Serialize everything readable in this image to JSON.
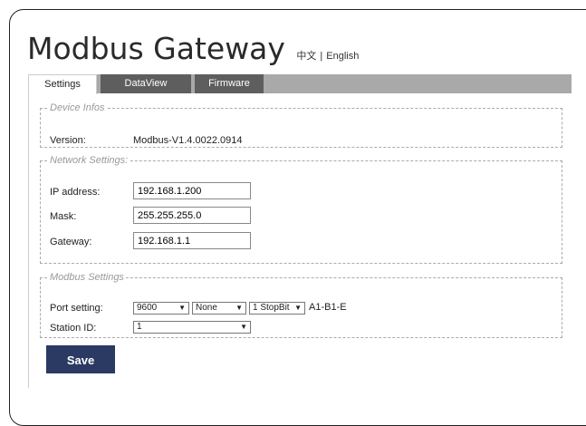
{
  "header": {
    "title": "Modbus Gateway",
    "lang_zh": "中文",
    "lang_sep": "|",
    "lang_en": "English"
  },
  "tabs": [
    {
      "label": "Settings",
      "active": true
    },
    {
      "label": "DataView",
      "active": false
    },
    {
      "label": "Firmware",
      "active": false
    }
  ],
  "device_infos": {
    "legend": "Device Infos",
    "version_label": "Version:",
    "version_value": "Modbus-V1.4.0022.0914"
  },
  "network": {
    "legend": "Network Settings:",
    "ip_label": "IP address:",
    "ip_value": "192.168.1.200",
    "mask_label": "Mask:",
    "mask_value": "255.255.255.0",
    "gateway_label": "Gateway:",
    "gateway_value": "192.168.1.1"
  },
  "modbus": {
    "legend": "Modbus Settings",
    "port_label": "Port setting:",
    "baud_value": "9600",
    "parity_value": "None",
    "stopbit_value": "1 StopBit",
    "port_suffix": "A1-B1-E",
    "station_label": "Station ID:",
    "station_value": "1"
  },
  "save_label": "Save",
  "colors": {
    "tab_inactive": "#5e5e5e",
    "tabbar": "#a9a9a9",
    "save_bg": "#2b3a63"
  }
}
